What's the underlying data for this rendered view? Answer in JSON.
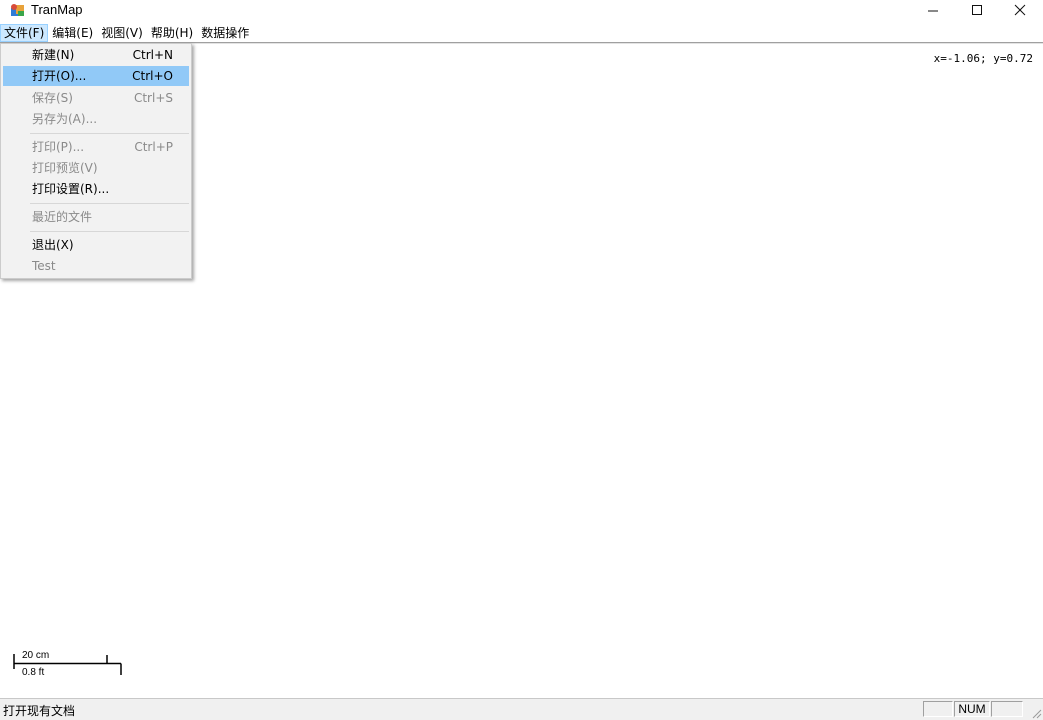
{
  "window": {
    "title": "TranMap",
    "minimize_icon": "minimize-icon",
    "maximize_icon": "maximize-icon",
    "close_icon": "close-icon"
  },
  "menubar": {
    "items": [
      {
        "label": "文件(F)",
        "active": true
      },
      {
        "label": "编辑(E)"
      },
      {
        "label": "视图(V)"
      },
      {
        "label": "帮助(H)"
      },
      {
        "label": "数据操作"
      }
    ]
  },
  "file_menu": {
    "items": [
      {
        "label": "新建(N)",
        "shortcut": "Ctrl+N",
        "enabled": true
      },
      {
        "label": "打开(O)...",
        "shortcut": "Ctrl+O",
        "enabled": true,
        "highlighted": true
      },
      {
        "label": "保存(S)",
        "shortcut": "Ctrl+S",
        "enabled": false
      },
      {
        "label": "另存为(A)...",
        "shortcut": "",
        "enabled": false
      },
      {
        "label": "打印(P)...",
        "shortcut": "Ctrl+P",
        "enabled": false
      },
      {
        "label": "打印预览(V)",
        "shortcut": "",
        "enabled": false
      },
      {
        "label": "打印设置(R)...",
        "shortcut": "",
        "enabled": true
      },
      {
        "label": "最近的文件",
        "shortcut": "",
        "enabled": false
      },
      {
        "label": "退出(X)",
        "shortcut": "",
        "enabled": true
      },
      {
        "label": "Test",
        "shortcut": "",
        "enabled": false
      }
    ]
  },
  "canvas": {
    "coordinates": "x=-1.06; y=0.72",
    "scale_bar": {
      "metric_label": "20 cm",
      "imperial_label": "0.8 ft"
    }
  },
  "statusbar": {
    "message": "打开现有文档",
    "panes": [
      "",
      "NUM",
      ""
    ]
  },
  "colors": {
    "menu_highlight": "#91c9f7",
    "menubar_active": "#cce8ff",
    "disabled_text": "#8a8a8a"
  }
}
